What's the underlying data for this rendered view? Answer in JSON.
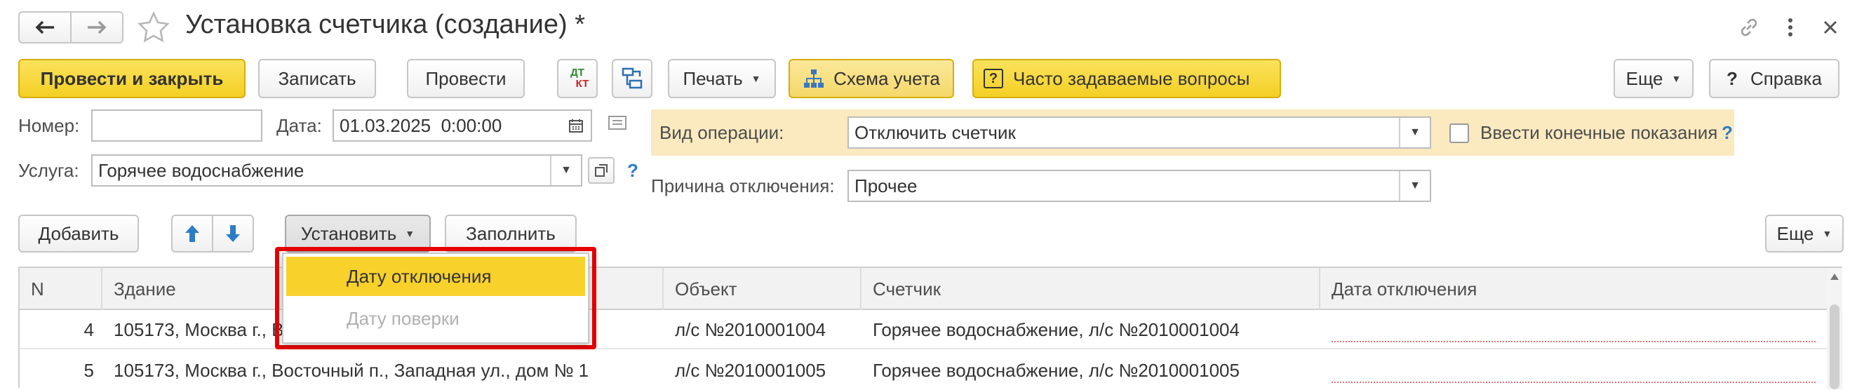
{
  "window": {
    "title": "Установка счетчика (создание) *",
    "back_icon": "arrow-left-icon",
    "forward_icon": "arrow-right-icon",
    "favorite_icon": "star-icon",
    "link_icon": "link-icon",
    "more_icon": "more-vertical-icon",
    "close_icon": "close-icon"
  },
  "toolbar": {
    "post_close": "Провести и закрыть",
    "save": "Записать",
    "post": "Провести",
    "dtkt_top": "ДТ",
    "dtkt_bottom": "КТ",
    "print": "Печать",
    "scheme": "Схема учета",
    "faq_mark": "?",
    "faq": "Часто задаваемые вопросы",
    "more": "Еще",
    "help_mark": "?",
    "help": "Справка"
  },
  "form": {
    "number_label": "Номер:",
    "number_value": "",
    "date_label": "Дата:",
    "date_value": "01.03.2025  0:00:00",
    "service_label": "Услуга:",
    "service_value": "Горячее водоснабжение",
    "service_help": "?",
    "operation_label": "Вид операции:",
    "operation_value": "Отключить счетчик",
    "final_readings_label": "Ввести конечные показания",
    "final_readings_checked": false,
    "final_help": "?",
    "reason_label": "Причина отключения:",
    "reason_value": "Прочее"
  },
  "table_toolbar": {
    "add": "Добавить",
    "set": "Установить",
    "fill": "Заполнить",
    "more": "Еще"
  },
  "dropdown": {
    "items": [
      {
        "label": "Дату отключения",
        "enabled": true,
        "highlighted": true
      },
      {
        "label": "Дату поверки",
        "enabled": false,
        "highlighted": false
      }
    ],
    "highlight_color": "#e60000"
  },
  "table": {
    "columns": [
      "N",
      "Здание",
      "Объект",
      "Счетчик",
      "Дата отключения"
    ],
    "rows": [
      {
        "n": "4",
        "building": "105173, Москва г., Восточный п., Западная ул., дом № 1",
        "object": "л/с №2010001004",
        "meter": "Горячее водоснабжение, л/с №2010001004",
        "date": ""
      },
      {
        "n": "5",
        "building": "105173, Москва г., Восточный п., Западная ул., дом № 1",
        "object": "л/с №2010001005",
        "meter": "Горячее водоснабжение, л/с №2010001005",
        "date": ""
      }
    ]
  },
  "colors": {
    "accent_yellow": "#f4cf24",
    "highlight_panel": "#fbeac0",
    "selection": "#f8d12b",
    "frame_red": "#e60000"
  }
}
